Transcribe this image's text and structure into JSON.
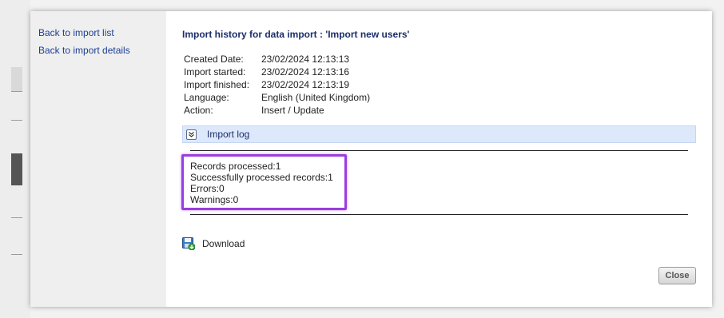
{
  "sidebar": {
    "links": [
      {
        "label": "Back to import list"
      },
      {
        "label": "Back to import details"
      }
    ]
  },
  "main": {
    "title": "Import history for data import : 'Import new users'",
    "info": [
      {
        "key": "Created Date:",
        "value": "23/02/2024 12:13:13"
      },
      {
        "key": "Import started:",
        "value": "23/02/2024 12:13:16"
      },
      {
        "key": "Import finished:",
        "value": "23/02/2024 12:13:19"
      },
      {
        "key": "Language:",
        "value": "English (United Kingdom)"
      },
      {
        "key": "Action:",
        "value": "Insert / Update"
      }
    ],
    "log": {
      "header": "Import log",
      "icon": "chevron-down-icon",
      "lines": [
        "Records processed:1",
        "Successfully processed records:1",
        "Errors:0",
        "Warnings:0"
      ],
      "highlight_color": "#9a3de0"
    },
    "download": {
      "label": "Download",
      "icon": "download-disk-icon"
    },
    "close": {
      "label": "Close"
    }
  }
}
